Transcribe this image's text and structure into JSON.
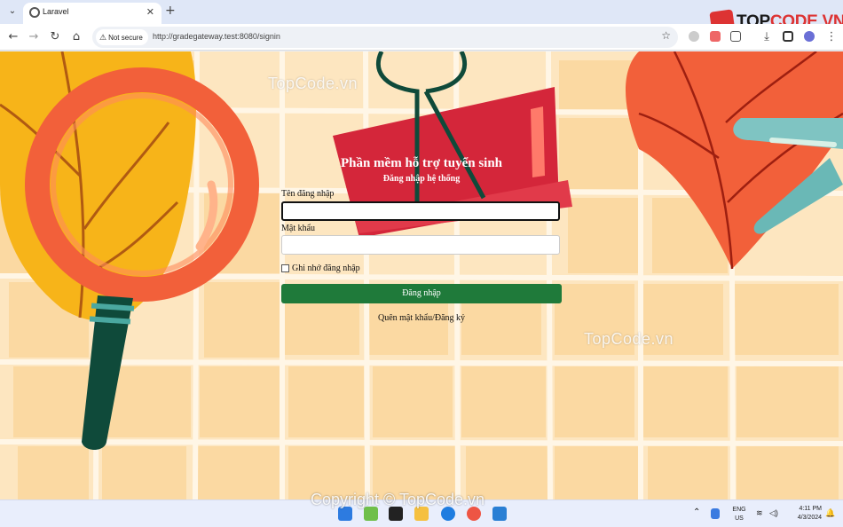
{
  "browser": {
    "tab_title": "Laravel",
    "new_tab": "+",
    "close": "✕",
    "security_label": "Not secure",
    "url": "http://gradegateway.test:8080/signin",
    "brand": {
      "prefix": "TOP",
      "suffix": "CODE.VN"
    }
  },
  "watermarks": [
    "TopCode.vn",
    "TopCode.vn"
  ],
  "login": {
    "title": "Phần mềm hỗ trợ tuyển sinh",
    "subtitle": "Đăng nhập hệ thống",
    "username_label": "Tên đăng nhập",
    "username_value": "",
    "password_label": "Mật khẩu",
    "password_value": "",
    "remember_label": "Ghi nhớ đăng nhập",
    "submit_label": "Đăng nhập",
    "links_text": "Quên mật khẩu/Đăng ký"
  },
  "taskbar": {
    "copyright": "Copyright © TopCode.vn",
    "lang": "ENG",
    "region": "US",
    "time": "4:11 PM",
    "date": "4/3/2024"
  },
  "colors": {
    "primary_button": "#1f7a3a",
    "brand_red": "#d33"
  }
}
